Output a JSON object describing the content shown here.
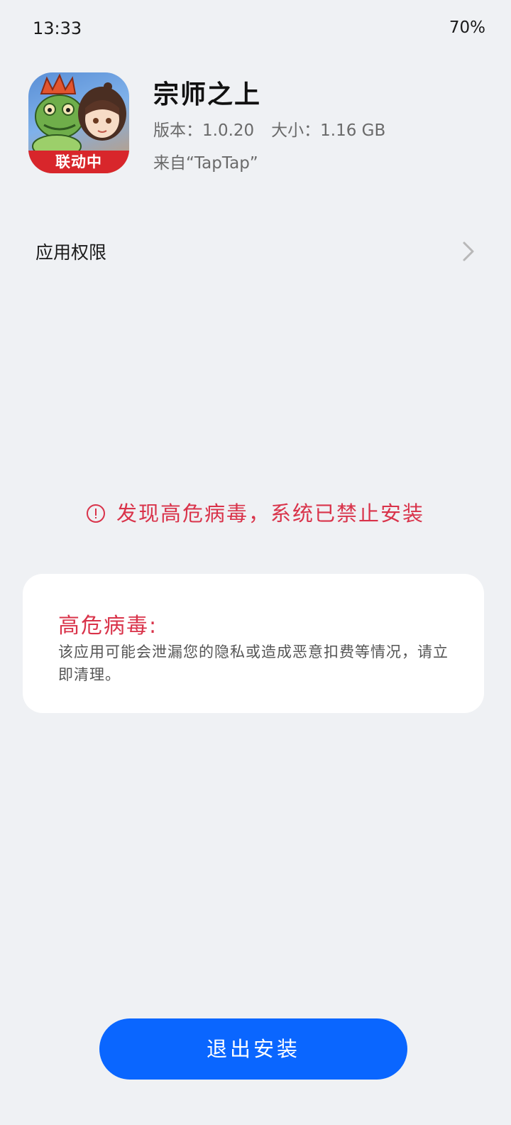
{
  "status_bar": {
    "time": "13:33",
    "battery": "70%"
  },
  "app": {
    "name": "宗师之上",
    "version_label": "版本：1.0.20",
    "size_label": "大小：1.16 GB",
    "source": "来自“TapTap”",
    "icon_badge": "联动中"
  },
  "permissions": {
    "label": "应用权限"
  },
  "warning": {
    "text": "发现高危病毒，系统已禁止安装",
    "color": "#d9334a"
  },
  "virus_card": {
    "title": "高危病毒:",
    "description": "该应用可能会泄漏您的隐私或造成恶意扣费等情况，请立即清理。"
  },
  "actions": {
    "exit_label": "退出安装",
    "accent_color": "#0a66ff"
  }
}
